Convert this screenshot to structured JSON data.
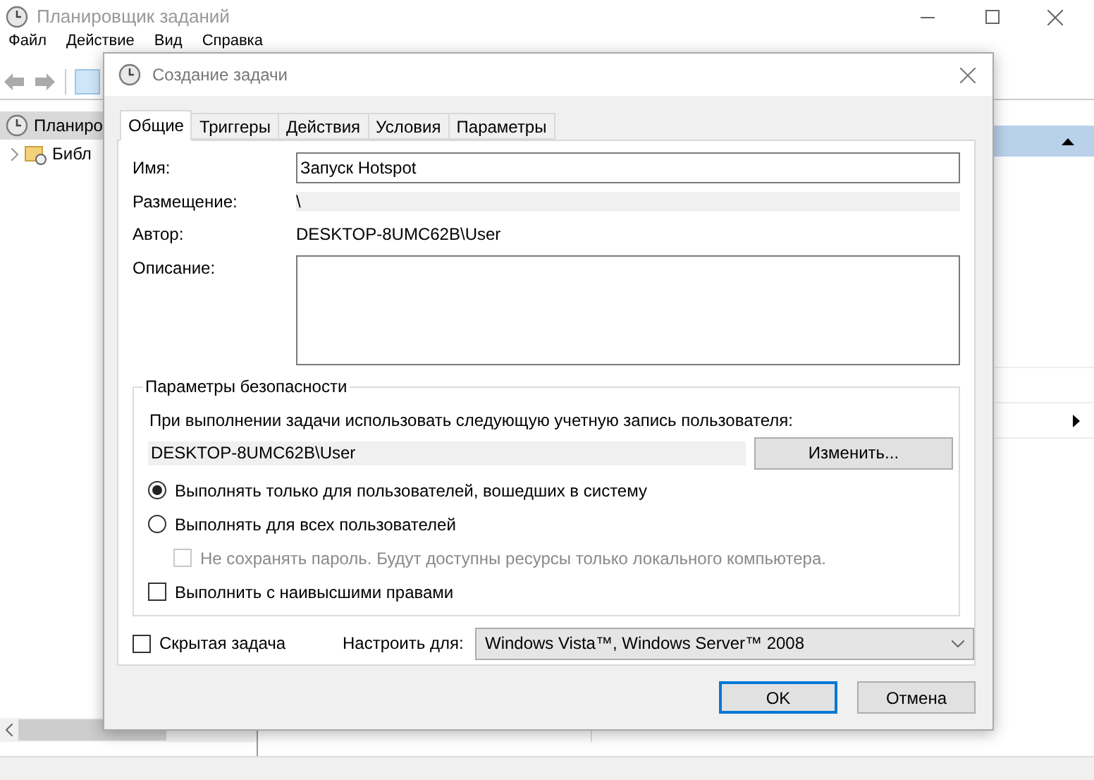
{
  "main_window": {
    "title": "Планировщик заданий",
    "menu": [
      "Файл",
      "Действие",
      "Вид",
      "Справка"
    ],
    "tree": [
      {
        "label": "Планиро",
        "selected": true,
        "children": [
          {
            "label": "Библ",
            "selected": false
          }
        ]
      }
    ]
  },
  "dialog": {
    "title": "Создание задачи",
    "tabs": [
      {
        "label": "Общие",
        "selected": true
      },
      {
        "label": "Триггеры",
        "selected": false
      },
      {
        "label": "Действия",
        "selected": false
      },
      {
        "label": "Условия",
        "selected": false
      },
      {
        "label": "Параметры",
        "selected": false
      }
    ],
    "name": {
      "label": "Имя:",
      "value": "Запуск Hotspot"
    },
    "location": {
      "label": "Размещение:",
      "value": "\\"
    },
    "author": {
      "label": "Автор:",
      "value": "DESKTOP-8UMC62B\\User"
    },
    "description": {
      "label": "Описание:"
    },
    "security": {
      "title": "Параметры безопасности",
      "prompt": "При выполнении задачи использовать следующую учетную запись пользователя:",
      "account": "DESKTOP-8UMC62B\\User",
      "change_button": "Изменить...",
      "options": [
        {
          "kind": "radio",
          "label": "Выполнять только для пользователей, вошедших в систему",
          "selected": true,
          "disabled": false,
          "indented": false
        },
        {
          "kind": "radio",
          "label": "Выполнять для всех пользователей",
          "selected": false,
          "disabled": false,
          "indented": false
        },
        {
          "kind": "checkbox",
          "label": "Не сохранять пароль. Будут доступны ресурсы только локального компьютера.",
          "checked": false,
          "disabled": true,
          "indented": true
        },
        {
          "kind": "checkbox",
          "label": "Выполнить с наивысшими правами",
          "checked": false,
          "disabled": false,
          "indented": false
        }
      ]
    },
    "hidden": {
      "label": "Скрытая задача",
      "checked": false
    },
    "configure": {
      "label": "Настроить для:",
      "value": "Windows Vista™, Windows Server™ 2008"
    },
    "buttons": [
      {
        "label": "OK",
        "kind": "default"
      },
      {
        "label": "Отмена",
        "kind": "normal"
      }
    ]
  }
}
